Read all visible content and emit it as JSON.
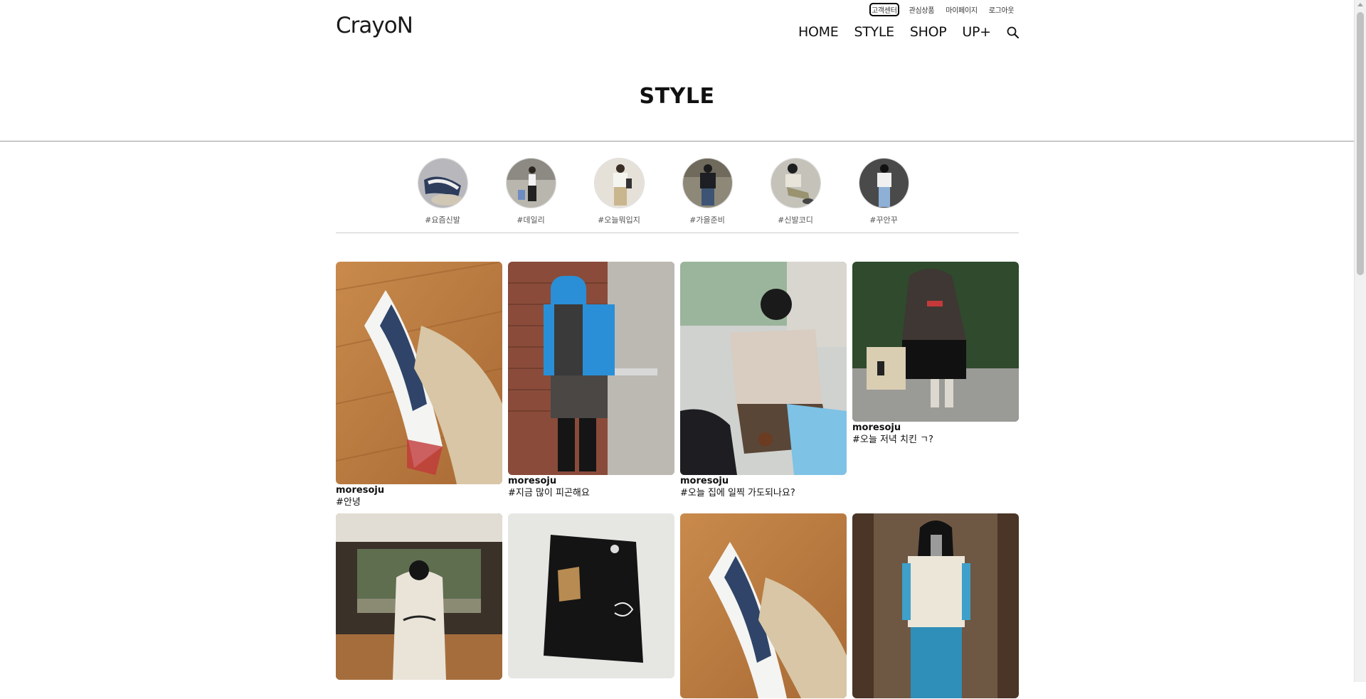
{
  "header": {
    "logo": "CrayoN",
    "utility_links": [
      "고객센터",
      "관심상품",
      "마이페이지",
      "로그아웃"
    ],
    "nav": [
      "HOME",
      "STYLE",
      "SHOP",
      "UP+"
    ]
  },
  "page": {
    "title": "STYLE"
  },
  "hashtags": [
    {
      "label": "#요즘신발"
    },
    {
      "label": "#데일리"
    },
    {
      "label": "#오늘뭐입지"
    },
    {
      "label": "#가을준비"
    },
    {
      "label": "#신발코디"
    },
    {
      "label": "#꾸안꾸"
    }
  ],
  "posts": [
    {
      "user": "moresoju",
      "caption": "#안녕"
    },
    {
      "user": "moresoju",
      "caption": "#지금 많이 피곤해요"
    },
    {
      "user": "moresoju",
      "caption": "#오늘 집에 일찍 가도되나요?"
    },
    {
      "user": "moresoju",
      "caption": "#오늘 저녁 치킨 ㄱ?"
    },
    {
      "user": "",
      "caption": ""
    },
    {
      "user": "",
      "caption": ""
    },
    {
      "user": "",
      "caption": ""
    },
    {
      "user": "",
      "caption": ""
    }
  ],
  "colors": {
    "accent": "#111111",
    "rule": "#9a9a9a",
    "background": "#ffffff"
  },
  "icons": {
    "search": "search-icon"
  }
}
